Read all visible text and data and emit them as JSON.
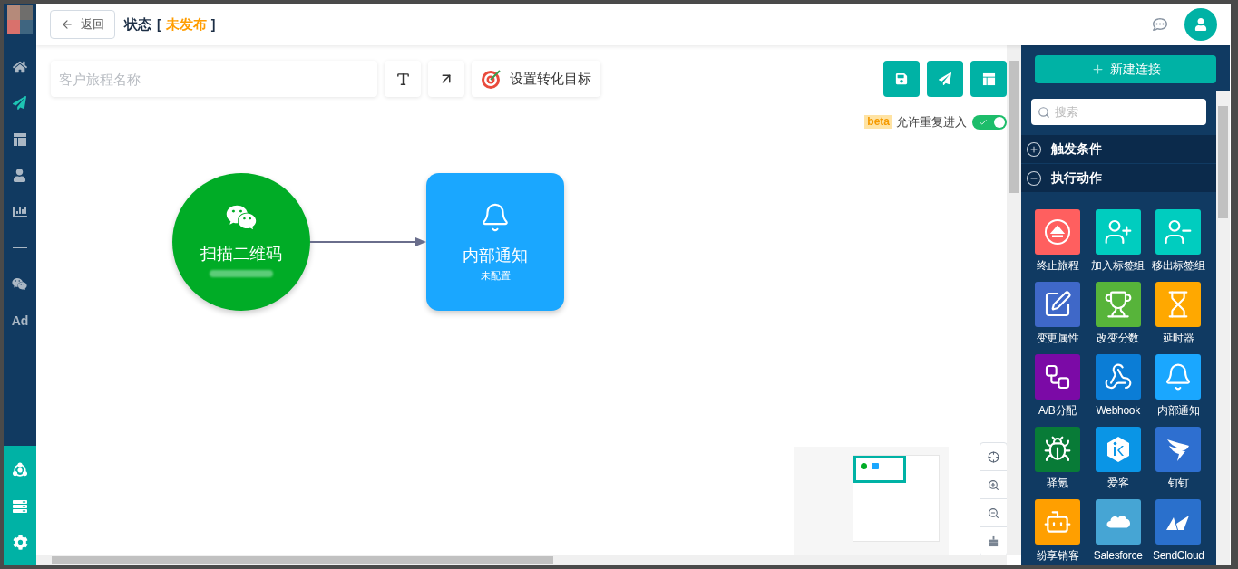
{
  "header": {
    "back_button": "返回",
    "status_label": "状态",
    "status_open": "[",
    "status_value": "未发布",
    "status_close": "]"
  },
  "sidebar": {
    "items": [
      {
        "kind": "home",
        "selected": false
      },
      {
        "kind": "send",
        "selected": true
      },
      {
        "kind": "layout",
        "selected": false
      },
      {
        "kind": "user",
        "selected": false
      },
      {
        "kind": "chart",
        "selected": false
      },
      {
        "kind": "divider",
        "selected": false
      },
      {
        "kind": "wechat",
        "selected": false
      },
      {
        "kind": "text",
        "label": "Ad",
        "selected": false
      }
    ],
    "bottom_items": [
      {
        "kind": "hub"
      },
      {
        "kind": "server"
      },
      {
        "kind": "settings"
      }
    ]
  },
  "toolbar": {
    "name_field": {
      "placeholder": "客户旅程名称"
    },
    "goal_button": "设置转化目标"
  },
  "options": {
    "badge": "beta",
    "label": "允许重复进入",
    "toggle": {
      "on": true
    }
  },
  "canvas": {
    "nodes": [
      {
        "kind": "trigger",
        "title": "扫描二维码"
      },
      {
        "kind": "action",
        "title": "内部通知",
        "subtitle": "未配置"
      }
    ]
  },
  "panel": {
    "new_button": "新建连接",
    "search": {
      "placeholder": "搜索"
    },
    "sections": [
      {
        "title": "触发条件",
        "expanded": false
      },
      {
        "title": "执行动作",
        "expanded": true
      }
    ],
    "actions": [
      {
        "kind": "eject",
        "label": "终止旅程",
        "color": "#ff5f5f"
      },
      {
        "kind": "user-plus",
        "label": "加入标签组",
        "color": "#00cdbf"
      },
      {
        "kind": "user-minus",
        "label": "移出标签组",
        "color": "#00cdbf"
      },
      {
        "kind": "edit",
        "label": "变更属性",
        "color": "#3f68c8"
      },
      {
        "kind": "trophy",
        "label": "改变分数",
        "color": "#57b43a"
      },
      {
        "kind": "hourglass",
        "label": "延时器",
        "color": "#ffa800"
      },
      {
        "kind": "split",
        "label": "A/B分配",
        "color": "#7b0aa6"
      },
      {
        "kind": "webhook",
        "label": "Webhook",
        "color": "#0b7dd6"
      },
      {
        "kind": "bell",
        "label": "内部通知",
        "color": "#1aa7ff"
      },
      {
        "kind": "spider",
        "label": "驿氪",
        "color": "#087b37"
      },
      {
        "kind": "hexagon",
        "label": "爱客",
        "color": "#0a95e6"
      },
      {
        "kind": "wing",
        "label": "钉钉",
        "color": "#2e6fd0"
      },
      {
        "kind": "bot",
        "label": "纷享销客",
        "color": "#ff9f00"
      },
      {
        "kind": "cloud",
        "label": "Salesforce",
        "color": "#46a5d4"
      },
      {
        "kind": "peaks",
        "label": "SendCloud",
        "color": "#2a70cc"
      }
    ]
  }
}
